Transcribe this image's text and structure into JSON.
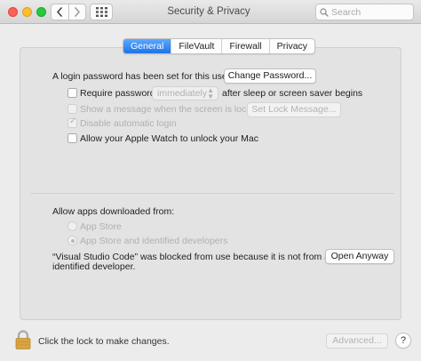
{
  "window": {
    "title": "Security & Privacy"
  },
  "search": {
    "placeholder": "Search"
  },
  "tabs": [
    {
      "label": "General",
      "active": true
    },
    {
      "label": "FileVault",
      "active": false
    },
    {
      "label": "Firewall",
      "active": false
    },
    {
      "label": "Privacy",
      "active": false
    }
  ],
  "general": {
    "login_password_text": "A login password has been set for this user",
    "change_password_button": "Change Password...",
    "require_password_label": "Require password",
    "require_password_checked": false,
    "require_password_delay": "immediately",
    "require_password_suffix": "after sleep or screen saver begins",
    "show_message_label": "Show a message when the screen is locked",
    "show_message_checked": false,
    "set_lock_message_button": "Set Lock Message...",
    "disable_auto_login_label": "Disable automatic login",
    "disable_auto_login_checked": true,
    "apple_watch_label": "Allow your Apple Watch to unlock your Mac",
    "apple_watch_checked": false
  },
  "downloads": {
    "heading": "Allow apps downloaded from:",
    "options": [
      {
        "label": "App Store",
        "selected": false
      },
      {
        "label": "App Store and identified developers",
        "selected": true
      }
    ],
    "blocked_message_line1": "“Visual Studio Code” was blocked from use because it is not from an",
    "blocked_message_line2": "identified developer.",
    "open_anyway_button": "Open Anyway"
  },
  "footer": {
    "lock_text": "Click the lock to make changes.",
    "advanced_button": "Advanced...",
    "help_button": "?"
  },
  "colors": {
    "accent": "#1c73e9",
    "lock_gold": "#d9a441"
  },
  "icons": [
    "back-icon",
    "forward-icon",
    "grid-icon",
    "search-icon",
    "lock-icon",
    "help-icon"
  ]
}
